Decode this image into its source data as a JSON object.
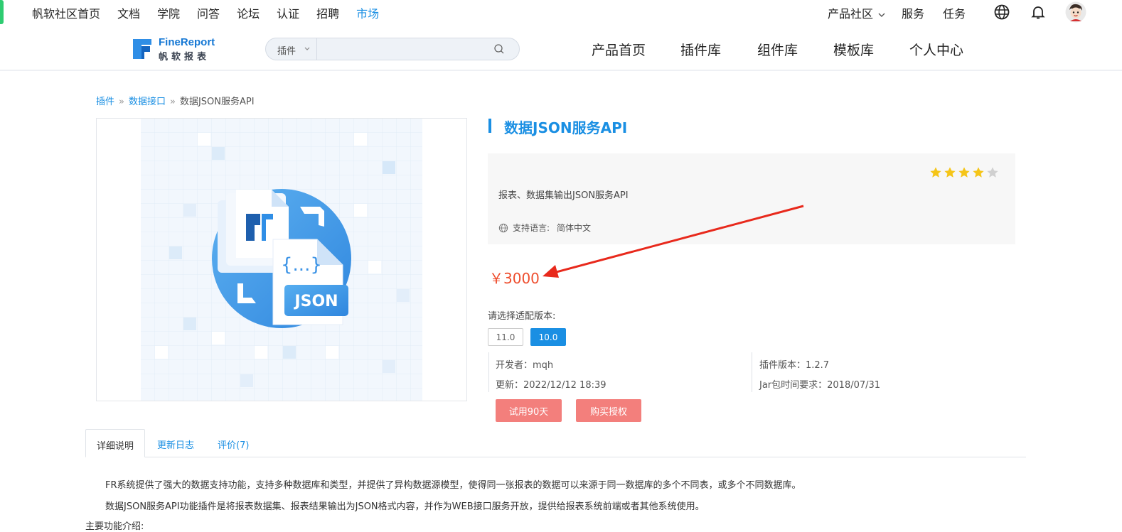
{
  "topnav": {
    "items": [
      "帆软社区首页",
      "文档",
      "学院",
      "问答",
      "论坛",
      "认证",
      "招聘",
      "市场"
    ],
    "active_index": 7,
    "right": {
      "community": "产品社区",
      "service": "服务",
      "task": "任务"
    }
  },
  "header": {
    "logo_en": "FineReport",
    "logo_cn": "帆软报表",
    "search": {
      "type": "插件",
      "placeholder": ""
    },
    "nav": [
      "产品首页",
      "插件库",
      "组件库",
      "模板库",
      "个人中心"
    ]
  },
  "breadcrumb": {
    "items": [
      "插件",
      "数据接口"
    ],
    "current": "数据JSON服务API"
  },
  "plugin": {
    "title": "数据JSON服务API",
    "description": "报表、数据集输出JSON服务API",
    "language_label": "支持语言:",
    "language": "简体中文",
    "rating": 4,
    "rating_max": 5,
    "price": "￥3000",
    "version_label": "请选择适配版本:",
    "versions": [
      "11.0",
      "10.0"
    ],
    "selected_version": "10.0",
    "developer": "开发者：mqh",
    "updated": "更新：2022/12/12 18:39",
    "plugin_version": "插件版本：1.2.7",
    "jar_requirement": "Jar包时间要求：2018/07/31",
    "trial_button": "试用90天",
    "buy_button": "购买授权",
    "image_label": "JSON",
    "image_braces": "{...}"
  },
  "tabs": [
    "详细说明",
    "更新日志",
    "评价(7)"
  ],
  "content": {
    "p1": "FR系统提供了强大的数据支持功能，支持多种数据库和类型，并提供了异构数据源模型，使得同一张报表的数据可以来源于同一数据库的多个不同表，或多个不同数据库。",
    "p2": "数据JSON服务API功能插件是将报表数据集、报表结果输出为JSON格式内容，并作为WEB接口服务开放，提供给报表系统前端或者其他系统使用。",
    "p3": "主要功能介绍:"
  },
  "colors": {
    "accent": "#1a8fe3",
    "price": "#ee4d2d",
    "button": "#f37f7c",
    "star": "#f5c518",
    "arrow": "#e8291c"
  }
}
